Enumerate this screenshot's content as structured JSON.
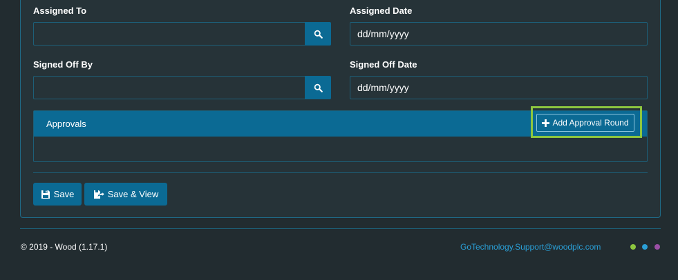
{
  "form": {
    "assigned_to": {
      "label": "Assigned To",
      "value": ""
    },
    "assigned_date": {
      "label": "Assigned Date",
      "value": "dd/mm/yyyy"
    },
    "signed_off_by": {
      "label": "Signed Off By",
      "value": ""
    },
    "signed_off_date": {
      "label": "Signed Off Date",
      "value": "dd/mm/yyyy"
    }
  },
  "approvals": {
    "title": "Approvals",
    "add_button_label": "Add Approval Round"
  },
  "actions": {
    "save_label": "Save",
    "save_view_label": "Save & View"
  },
  "footer": {
    "copyright": "© 2019 - Wood (1.17.1)",
    "support_email": "GoTechnology.Support@woodplc.com",
    "dots": [
      "#8dc63f",
      "#2a9fd6",
      "#9b4fa5"
    ]
  },
  "colors": {
    "accent": "#0b6a94",
    "highlight": "#8dc63f",
    "background": "#222c30"
  }
}
